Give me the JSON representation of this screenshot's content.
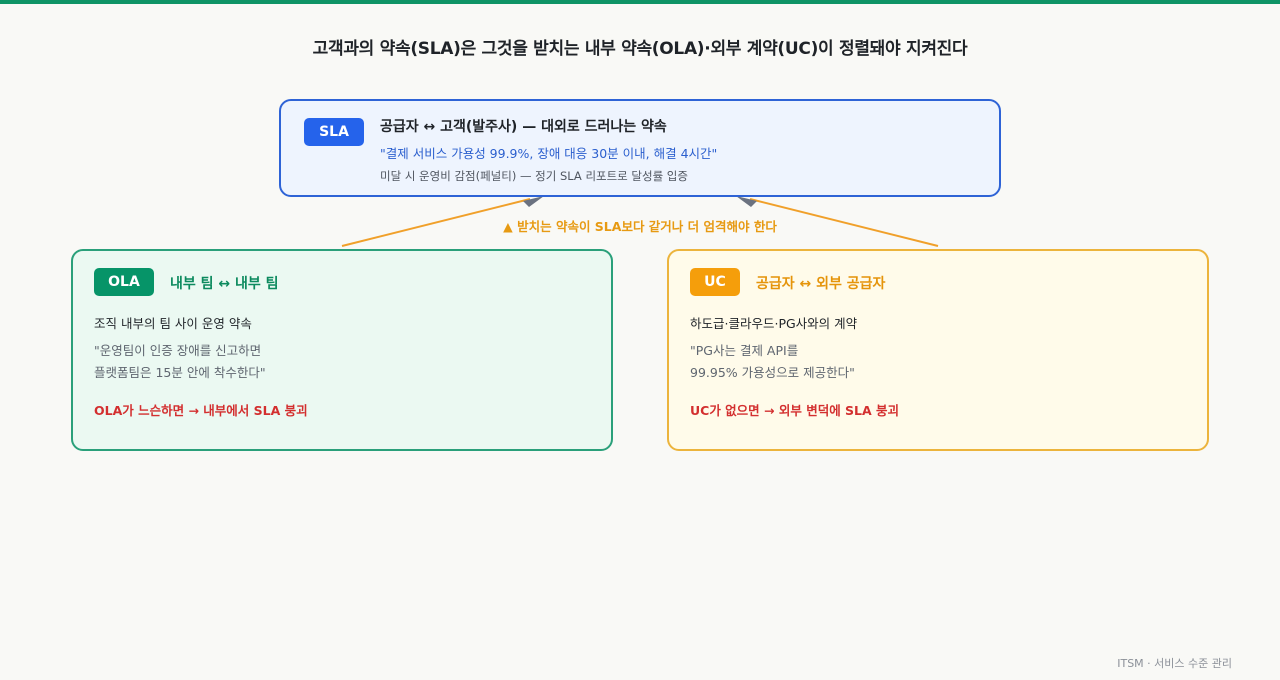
{
  "title": "고객과의 약속(SLA)은 그것을 받치는 내부 약속(OLA)·외부 계약(UC)이 정렬돼야 지켜진다",
  "sla": {
    "badge": "SLA",
    "heading": "공급자 ↔ 고객(발주사) — 대외로 드러나는 약속",
    "quote": "\"결제 서비스 가용성 99.9%, 장애 대응 30분 이내, 해결 4시간\"",
    "note": "미달 시 운영비 감점(페널티) — 정기 SLA 리포트로 달성률 입증"
  },
  "support_label": "▲ 받치는 약속이 SLA보다 같거나 더 엄격해야 한다",
  "ola": {
    "badge": "OLA",
    "heading": "내부 팀 ↔ 내부 팀",
    "desc": "조직 내부의 팀 사이 운영 약속",
    "quote_line1": "\"운영팀이 인증 장애를 신고하면",
    "quote_line2": "플랫폼팀은 15분 안에 착수한다\"",
    "warning": "OLA가 느슨하면 → 내부에서 SLA 붕괴"
  },
  "uc": {
    "badge": "UC",
    "heading": "공급자 ↔ 외부 공급자",
    "desc": "하도급·클라우드·PG사와의 계약",
    "quote_line1": "\"PG사는 결제 API를",
    "quote_line2": "99.95% 가용성으로 제공한다\"",
    "warning": "UC가 없으면 → 외부 변덕에 SLA 붕괴"
  },
  "footer": "ITSM · 서비스 수준 관리",
  "colors": {
    "accent_bar": "#0f9466",
    "sla": "#2563eb",
    "ola": "#069468",
    "uc": "#f59e0b",
    "connector": "#f0a02a",
    "arrowhead": "#6b7280",
    "warning": "#d32f2f"
  }
}
